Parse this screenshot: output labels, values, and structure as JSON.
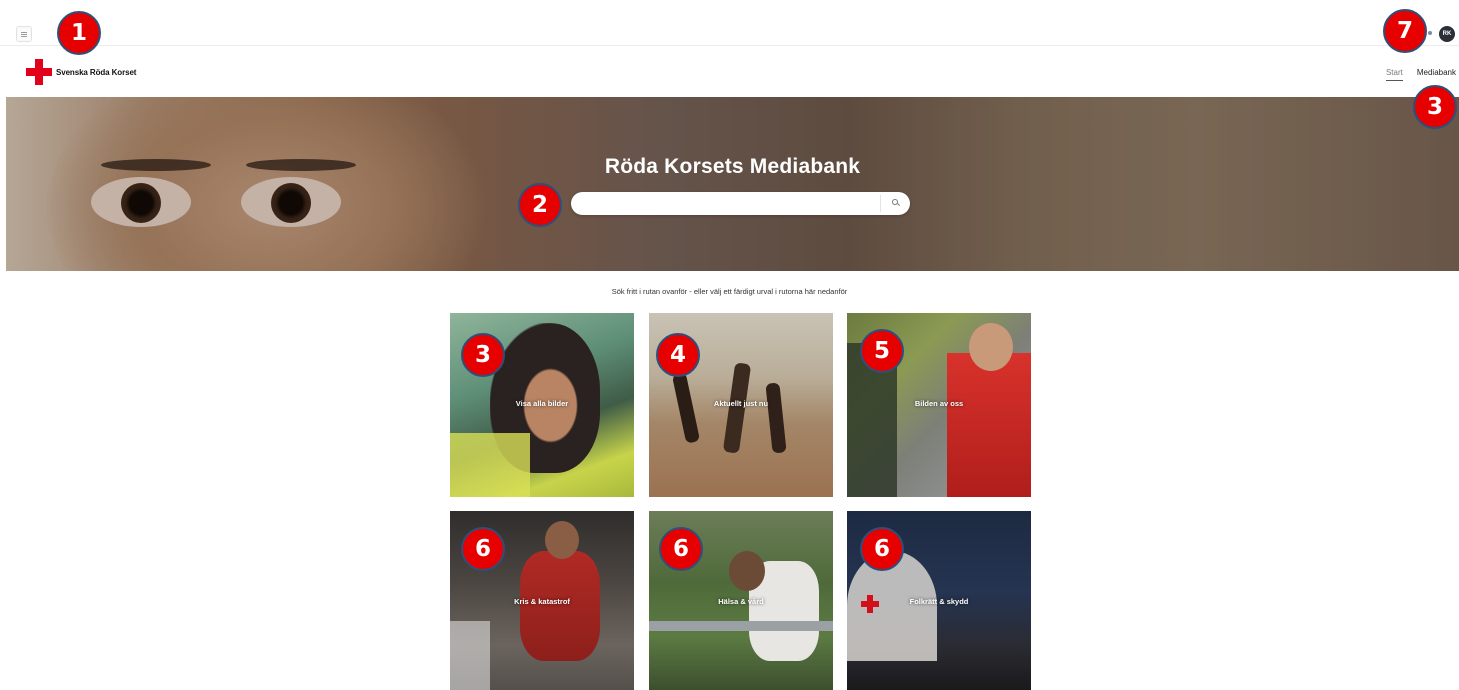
{
  "topbar": {
    "menu_icon": "hamburger-icon",
    "avatar_initials": "RK"
  },
  "header": {
    "logo_text": "Svenska Röda Korset",
    "nav": [
      {
        "label": "Start",
        "active": true
      },
      {
        "label": "Mediabank",
        "active": false
      }
    ]
  },
  "hero": {
    "title": "Röda Korsets Mediabank",
    "search_placeholder": "",
    "search_icon": "search-icon"
  },
  "subtitle": "Sök fritt i rutan ovanför - eller välj ett färdigt urval i rutorna här nedanför",
  "tiles": [
    {
      "label": "Visa alla bilder"
    },
    {
      "label": "Aktuellt just nu"
    },
    {
      "label": "Bilden av oss"
    },
    {
      "label": "Kris & katastrof"
    },
    {
      "label": "Hälsa & vård"
    },
    {
      "label": "Folkrätt & skydd"
    }
  ],
  "annotations": [
    "1",
    "2",
    "3",
    "3",
    "4",
    "5",
    "6",
    "6",
    "6",
    "7"
  ],
  "colors": {
    "brand_red": "#e3001b",
    "badge_red": "#e60000",
    "badge_border": "#2d4f7c",
    "avatar_bg": "#2b2e36"
  }
}
